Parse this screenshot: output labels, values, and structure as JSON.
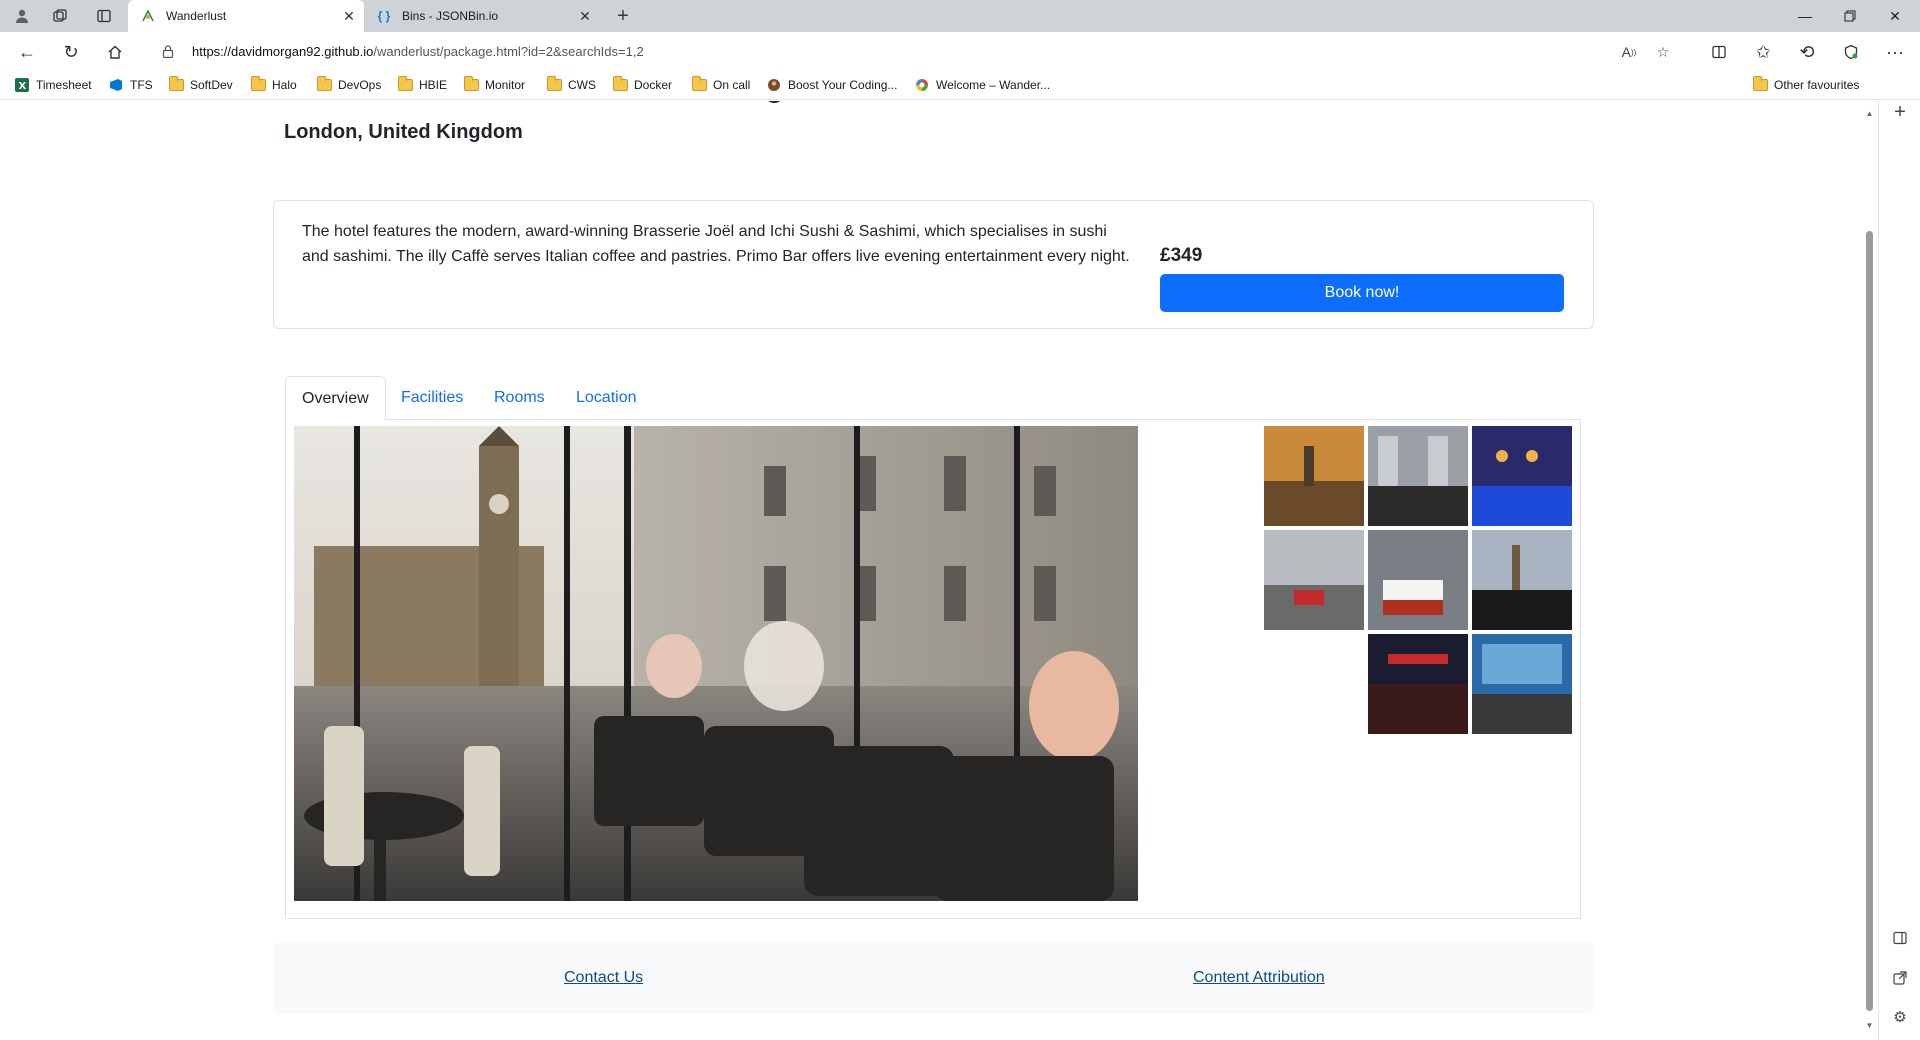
{
  "browser": {
    "tabs": [
      {
        "title": "Wanderlust",
        "active": true
      },
      {
        "title": "Bins - JSONBin.io",
        "active": false
      }
    ],
    "url_host": "https://davidmorgan92.github.io",
    "url_path": "/wanderlust/package.html?id=2&searchIds=1,2",
    "bookmarks": [
      {
        "label": "Timesheet",
        "icon": "excel-icon"
      },
      {
        "label": "TFS",
        "icon": "azure-devops-icon"
      },
      {
        "label": "SoftDev",
        "icon": "folder-icon"
      },
      {
        "label": "Halo",
        "icon": "folder-icon"
      },
      {
        "label": "DevOps",
        "icon": "folder-icon"
      },
      {
        "label": "HBIE",
        "icon": "folder-icon"
      },
      {
        "label": "Monitor",
        "icon": "folder-icon"
      },
      {
        "label": "CWS",
        "icon": "folder-icon"
      },
      {
        "label": "Docker",
        "icon": "folder-icon"
      },
      {
        "label": "On call",
        "icon": "folder-icon"
      },
      {
        "label": "Boost Your Coding...",
        "icon": "site-icon"
      },
      {
        "label": "Welcome – Wander...",
        "icon": "google-icon"
      }
    ],
    "other_favourites": "Other favourites"
  },
  "page": {
    "location": "London, United Kingdom",
    "description": "The hotel features the modern, award-winning Brasserie Joël and Ichi Sushi & Sashimi, which specialises in sushi and sashimi. The illy Caffè serves Italian coffee and pastries. Primo Bar offers live evening entertainment every night.",
    "price": "£349",
    "book_label": "Book now!",
    "tabs": [
      "Overview",
      "Facilities",
      "Rooms",
      "Location"
    ],
    "active_tab": "Overview",
    "footer": {
      "contact": "Contact Us",
      "attribution": "Content Attribution"
    }
  },
  "colors": {
    "primary": "#0d6efd",
    "link": "#0d4d86",
    "text": "#212529",
    "border": "#dee2e6",
    "footer_bg": "#f8f9fa"
  }
}
